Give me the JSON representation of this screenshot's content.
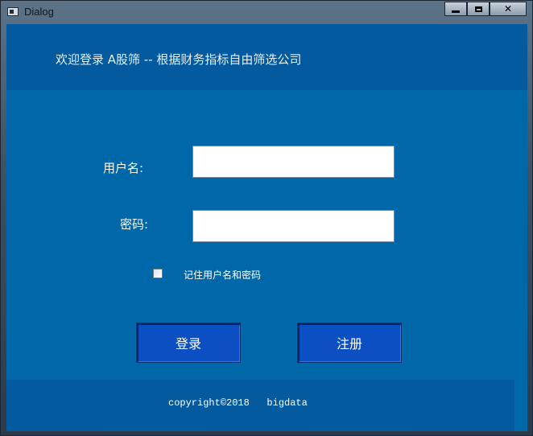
{
  "window": {
    "title": "Dialog",
    "buttons": {
      "minimize": "minimize",
      "maximize": "maximize",
      "close": "✕"
    }
  },
  "header": {
    "title": "欢迎登录  A股筛 -- 根据财务指标自由筛选公司"
  },
  "form": {
    "username_label": "用户名:",
    "username_value": "",
    "password_label": "密码:",
    "password_value": "",
    "remember_checked": false,
    "remember_label": "记住用户名和密码"
  },
  "actions": {
    "login_label": "登录",
    "register_label": "注册"
  },
  "footer": {
    "text": "copyright©2018   bigdata"
  },
  "colors": {
    "client_bg": "#0068a8",
    "header_bg": "#035a9e",
    "button_bg": "#0b4fc3"
  }
}
